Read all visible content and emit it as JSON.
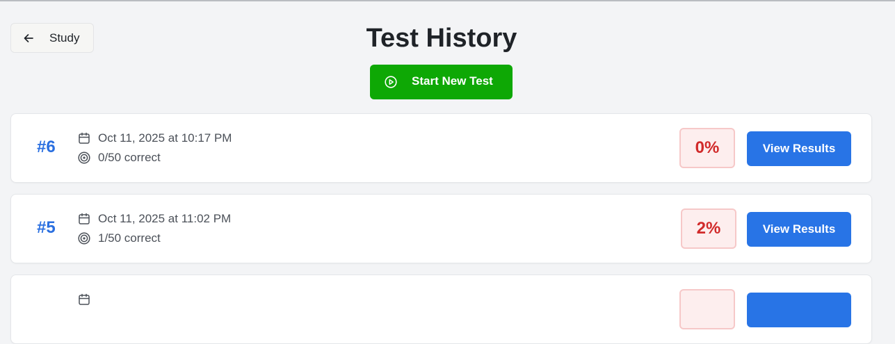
{
  "header": {
    "back_label": "Study",
    "title": "Test History",
    "start_label": "Start New Test"
  },
  "colors": {
    "accent_blue": "#2874e6",
    "start_green": "#0ea805",
    "score_red": "#d12a2a"
  },
  "tests": [
    {
      "number": "#6",
      "date": "Oct 11, 2025 at 10:17 PM",
      "score": "0/50 correct",
      "percent": "0%",
      "action": "View Results"
    },
    {
      "number": "#5",
      "date": "Oct 11, 2025 at 11:02 PM",
      "score": "1/50 correct",
      "percent": "2%",
      "action": "View Results"
    }
  ]
}
